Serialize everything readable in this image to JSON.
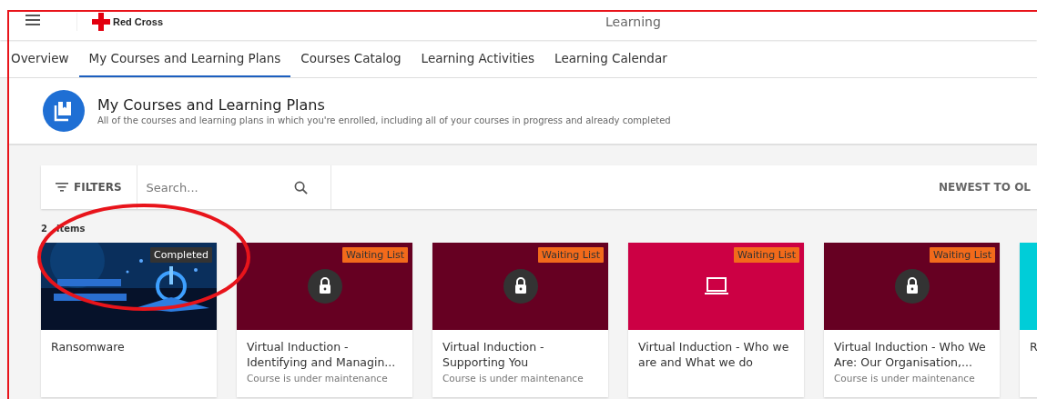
{
  "header": {
    "logo_text": "Red Cross",
    "title": "Learning"
  },
  "tabs": [
    {
      "label": "Overview",
      "selected": false
    },
    {
      "label": "My Courses and Learning Plans",
      "selected": true
    },
    {
      "label": "Courses Catalog",
      "selected": false
    },
    {
      "label": "Learning Activities",
      "selected": false
    },
    {
      "label": "Learning Calendar",
      "selected": false
    }
  ],
  "page_heading": {
    "title": "My Courses and Learning Plans",
    "subtitle": "All of the courses and learning plans in which you're enrolled, including all of your courses in progress and already completed"
  },
  "toolbar": {
    "filters": "FILTERS",
    "search": {
      "placeholder": "Search..."
    },
    "sort": "NEWEST TO OL"
  },
  "count": {
    "visible_digit": "2",
    "label": "items"
  },
  "courses": [
    {
      "kind": "picture",
      "badge": "Completed",
      "completed": true,
      "title": "Ransomware"
    },
    {
      "kind": "lock",
      "color": "#660022",
      "badge": "Waiting List",
      "completed": false,
      "title": "Virtual Induction - Identifying and Managin...",
      "note": "Course is under maintenance"
    },
    {
      "kind": "lock",
      "color": "#660022",
      "badge": "Waiting List",
      "completed": false,
      "title": "Virtual Induction - Supporting You",
      "note": "Course is under maintenance"
    },
    {
      "kind": "laptop",
      "color": "#cc0044",
      "badge": "Waiting List",
      "completed": false,
      "title": "Virtual Induction - Who we are and What we do"
    },
    {
      "kind": "lock",
      "color": "#660022",
      "badge": "Waiting List",
      "completed": false,
      "title": "Virtual Induction - Who We Are: Our Organisation,...",
      "note": "Course is under maintenance"
    },
    {
      "kind": "plain",
      "color": "#00cdd8",
      "title": "R"
    }
  ]
}
